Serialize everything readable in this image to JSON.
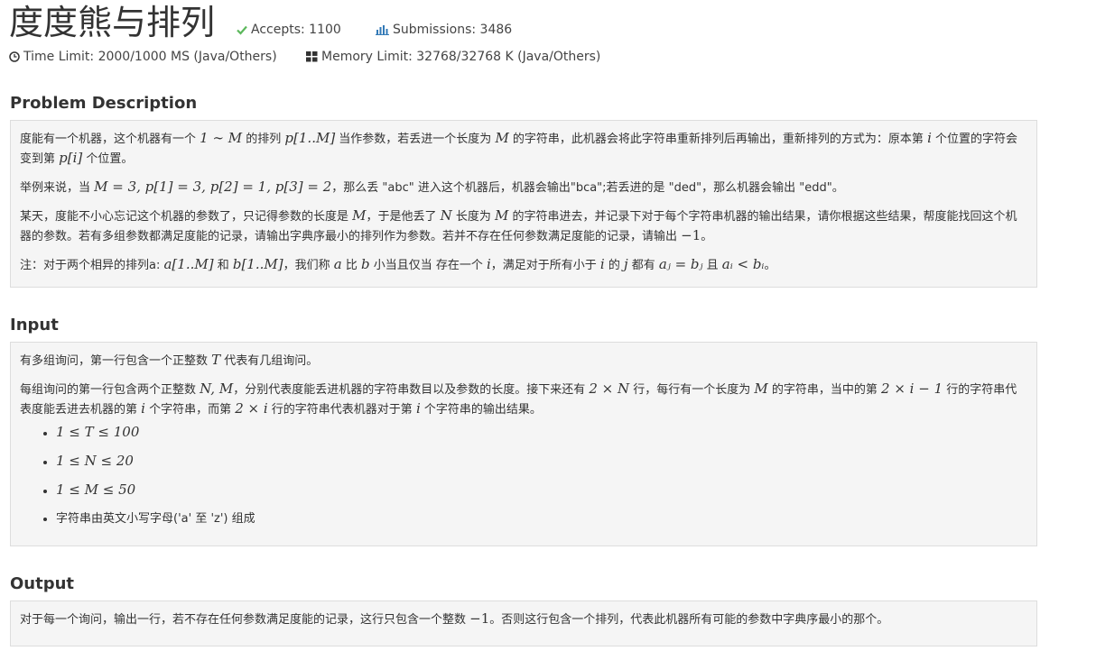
{
  "problem": {
    "title": "度度熊与排列",
    "accepts_label": "Accepts: 1100",
    "submissions_label": "Submissions: 3486",
    "time_limit_label": "Time Limit: 2000/1000 MS (Java/Others)",
    "memory_limit_label": "Memory Limit: 32768/32768 K (Java/Others)"
  },
  "sections": {
    "description_heading": "Problem Description",
    "input_heading": "Input",
    "output_heading": "Output"
  },
  "description": {
    "p1_a": "度能有一个机器，这个机器有一个 ",
    "p1_b": " 的排列 ",
    "p1_c": " 当作参数，若丢进一个长度为 ",
    "p1_d": " 的字符串，此机器会将此字符串重新排列后再输出，重新排列的方式为：原本第 ",
    "p1_e": " 个位置的字符会变到第 ",
    "p1_f": " 个位置。",
    "p2_a": "举例来说，当 ",
    "p2_b": "，那么丢 \"abc\" 进入这个机器后，机器会输出\"bca\";若丢进的是 \"ded\"，那么机器会输出 \"edd\"。",
    "p3_a": "某天，度能不小心忘记这个机器的参数了，只记得参数的长度是 ",
    "p3_b": "，于是他丢了 ",
    "p3_c": " 长度为 ",
    "p3_d": " 的字符串进去，并记录下对于每个字符串机器的输出结果，请你根据这些结果，帮度能找回这个机器的参数。若有多组参数都满足度能的记录，请输出字典序最小的排列作为参数。若并不存在任何参数满足度能的记录，请输出 ",
    "p3_e": "。",
    "p4_a": "注：对于两个相异的排列a: ",
    "p4_b": " 和 ",
    "p4_c": "，我们称 ",
    "p4_d": " 比 ",
    "p4_e": " 小当且仅当 存在一个 ",
    "p4_f": "，满足对于所有小于 ",
    "p4_g": " 的 ",
    "p4_h": " 都有 ",
    "p4_i": " 且 ",
    "p4_j": "。"
  },
  "input": {
    "p1_a": "有多组询问，第一行包含一个正整数 ",
    "p1_b": " 代表有几组询问。",
    "p2_a": "每组询问的第一行包含两个正整数 ",
    "p2_b": "，分别代表度能丢进机器的字符串数目以及参数的长度。接下来还有 ",
    "p2_c": " 行，每行有一个长度为 ",
    "p2_d": " 的字符串，当中的第 ",
    "p2_e": " 行的字符串代表度能丢进去机器的第 ",
    "p2_f": " 个字符串，而第 ",
    "p2_g": " 行的字符串代表机器对于第 ",
    "p2_h": " 个字符串的输出结果。",
    "constraints": [
      "1 ≤ T ≤ 100",
      "1 ≤ N ≤ 20",
      "1 ≤ M ≤ 50"
    ],
    "charset_note": "字符串由英文小写字母('a' 至 'z') 组成"
  },
  "output": {
    "p1_a": "对于每一个询问，输出一行，若不存在任何参数满足度能的记录，这行只包含一个整数 ",
    "p1_b": "。否则这行包含一个排列，代表此机器所有可能的参数中字典序最小的那个。"
  },
  "math": {
    "range": "1 ∼ M",
    "p_range": "p[1..M]",
    "M": "M",
    "i": "i",
    "p_i": "p[i]",
    "example": "M = 3, p[1] = 3, p[2] = 1, p[3] = 2",
    "N": "N",
    "neg1": "−1",
    "a_range": "a[1..M]",
    "b_range": "b[1..M]",
    "a": "a",
    "b": "b",
    "j": "j",
    "aj_eq_bj": "aⱼ = bⱼ",
    "ai_lt_bi": "aᵢ < bᵢ",
    "T": "T",
    "NM": "N, M",
    "two_N": "2 × N",
    "two_i_minus_1": "2 × i − 1",
    "two_i": "2 × i"
  },
  "colors": {
    "check_green": "#5cb85c",
    "box_bg": "#f5f5f5",
    "box_border": "#dddddd"
  },
  "icons": {
    "accepts": "check-icon",
    "submissions": "bar-chart-icon",
    "time": "clock-icon",
    "memory": "grid-icon"
  }
}
